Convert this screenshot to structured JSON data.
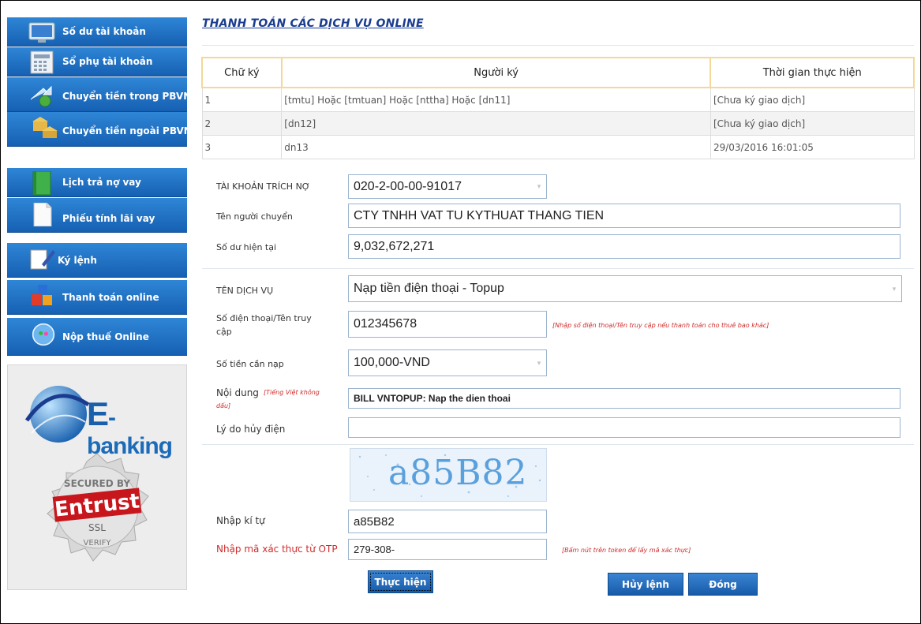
{
  "sidebar": {
    "items": [
      {
        "label": "Số dư tài khoản",
        "icon": "monitor-icon"
      },
      {
        "label": "Sổ phụ tài khoản",
        "icon": "calculator-icon"
      },
      {
        "label": "Chuyển tiền trong PBVN",
        "icon": "transfer-internal-icon"
      },
      {
        "label": "Chuyển tiền ngoài PBVN",
        "icon": "bank-building-icon"
      },
      {
        "label": "Lịch trả nợ vay",
        "icon": "book-icon"
      },
      {
        "label": "Phiếu tính lãi vay",
        "icon": "document-icon"
      },
      {
        "label": "Ký lệnh",
        "icon": "sign-pen-icon"
      },
      {
        "label": "Thanh toán online",
        "icon": "blocks-icon"
      },
      {
        "label": "Nộp thuế Online",
        "icon": "globe-people-icon"
      }
    ],
    "logo_text": "E-banking",
    "seal_lines": [
      "SECURED BY",
      "Entrust",
      "SSL",
      "VERIFY"
    ]
  },
  "page": {
    "title": "THANH TOÁN CÁC DỊCH VỤ ONLINE"
  },
  "signature_table": {
    "headers": [
      "Chữ ký",
      "Người ký",
      "Thời gian thực hiện"
    ],
    "rows": [
      [
        "1",
        "[tmtu] Hoặc [tmtuan] Hoặc [nttha] Hoặc [dn11]",
        "[Chưa ký giao dịch]"
      ],
      [
        "2",
        "[dn12]",
        "[Chưa ký giao dịch]"
      ],
      [
        "3",
        "dn13",
        "29/03/2016 16:01:05"
      ]
    ]
  },
  "form": {
    "debit_account": {
      "label": "TÀI KHOẢN TRÍCH NỢ",
      "value": "020-2-00-00-91017"
    },
    "sender_name": {
      "label": "Tên người chuyển",
      "value": "CTY TNHH VAT TU KYTHUAT THANG TIEN"
    },
    "balance": {
      "label": "Số dư hiện tại",
      "value": "9,032,672,271"
    },
    "service": {
      "label": "TÊN DỊCH VỤ",
      "value": "Nạp tiền điện thoại - Topup"
    },
    "phone": {
      "label_line1": "Số điện thoại/Tên truy",
      "label_line2": "cập",
      "value": "012345678",
      "hint": "[Nhập số điện thoại/Tên truy cập nếu thanh toán cho thuê bao khác]"
    },
    "amount": {
      "label": "Số tiền cần nạp",
      "value": "100,000-VND"
    },
    "content": {
      "label": "Nội dung",
      "note_line1": "[Tiếng Việt không",
      "note_line2": "dấu]",
      "value": "BILL VNTOPUP: Nap the dien thoai"
    },
    "cancel_reason": {
      "label": "Lý do hủy điện",
      "value": ""
    },
    "captcha": {
      "image_text": "a85B82",
      "label": "Nhập kí tự",
      "value": "a85B82"
    },
    "otp": {
      "label": "Nhập mã xác thực từ OTP",
      "value": "279-308-",
      "hint": "[Bấm nút trên token để lấy mã xác thực]"
    }
  },
  "buttons": {
    "execute": "Thực hiện",
    "cancel_order": "Hủy lệnh",
    "close": "Đóng"
  },
  "colors": {
    "nav_blue": "#1e6fc0",
    "title_blue": "#1a3c8f",
    "hint_red": "#d12b2b"
  }
}
